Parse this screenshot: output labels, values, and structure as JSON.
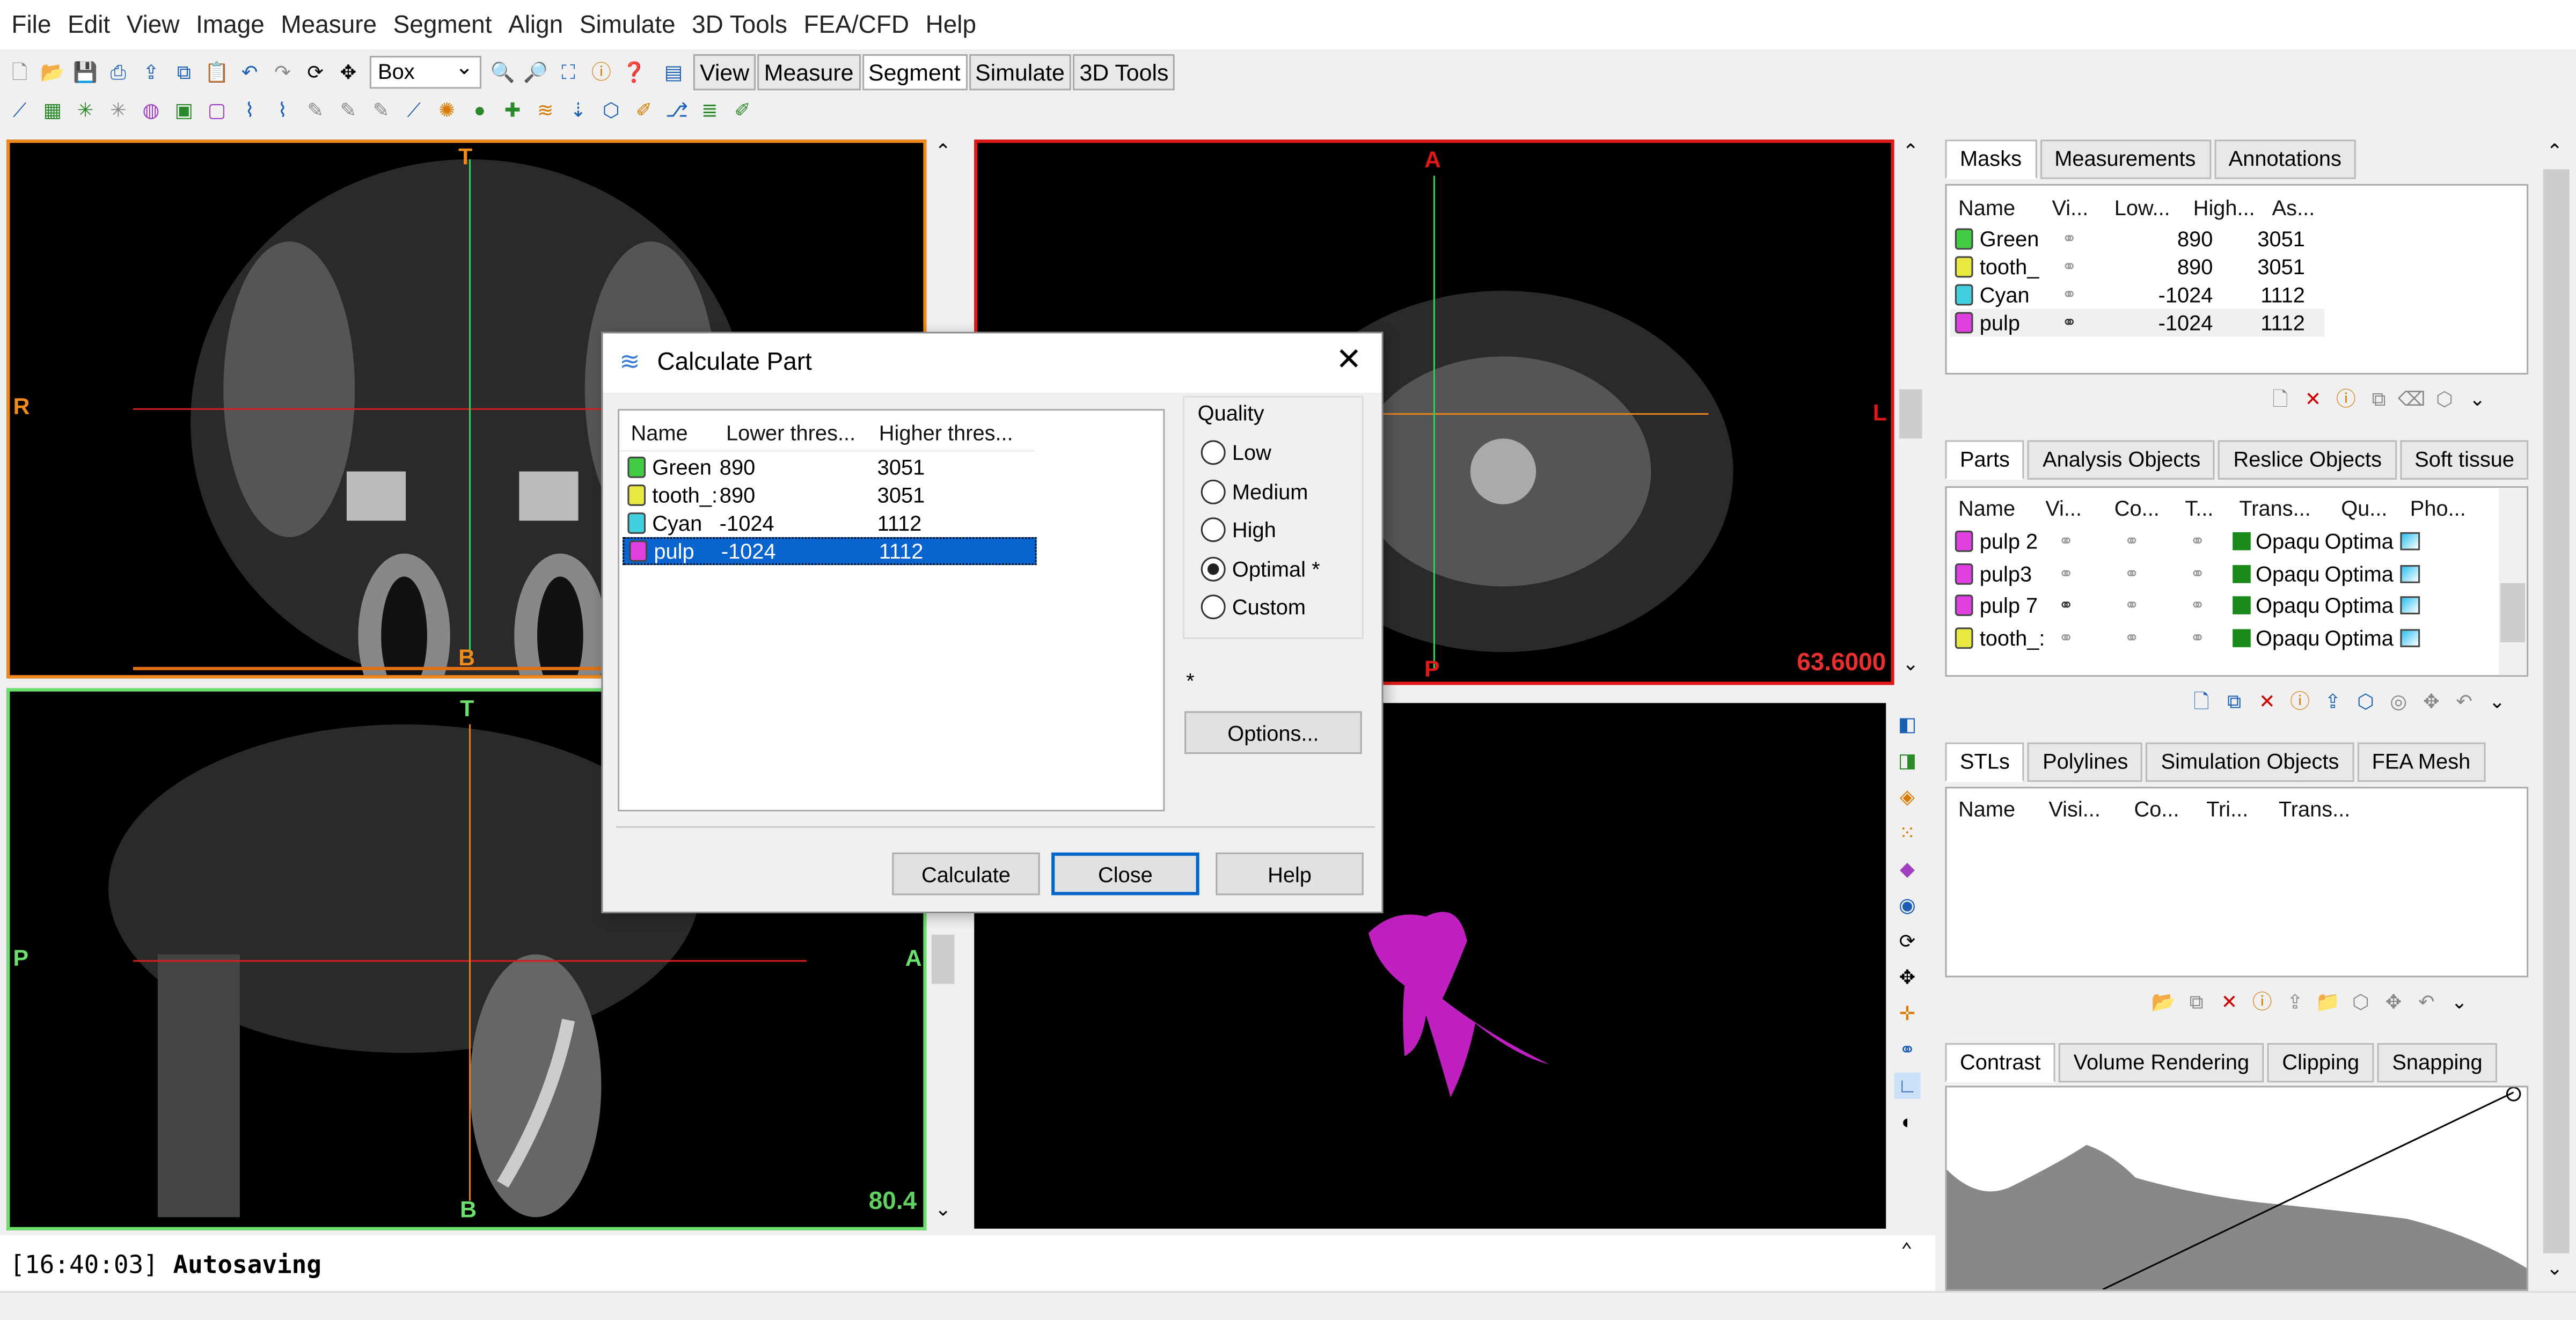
{
  "menu": [
    "File",
    "Edit",
    "View",
    "Image",
    "Measure",
    "Segment",
    "Align",
    "Simulate",
    "3D Tools",
    "FEA/CFD",
    "Help"
  ],
  "toolbar": {
    "select_value": "Box",
    "mode_tabs": [
      "View",
      "Measure",
      "Segment",
      "Simulate",
      "3D Tools"
    ],
    "active_mode": "Segment"
  },
  "viewports": {
    "top_left": {
      "top": "T",
      "left": "R",
      "bottom": "B"
    },
    "top_right": {
      "top": "A",
      "right": "L",
      "bottom": "P",
      "value": "63.6000",
      "value_color": "#e83030"
    },
    "bottom_left": {
      "top": "T",
      "left": "P",
      "right": "A",
      "bottom": "B",
      "value": "80.4",
      "value_color": "#60d060"
    }
  },
  "log": {
    "line1_time": "[16:40:03]",
    "line1_text": "Autosaving"
  },
  "masks_panel": {
    "tabs": [
      "Masks",
      "Measurements",
      "Annotations"
    ],
    "columns": [
      "Name",
      "Vi...",
      "Low...",
      "High...",
      "As..."
    ],
    "rows": [
      {
        "name": "Green",
        "low": "890",
        "high": "3051",
        "color": "#44cc44"
      },
      {
        "name": "tooth_",
        "low": "890",
        "high": "3051",
        "color": "#e8e840"
      },
      {
        "name": "Cyan",
        "low": "-1024",
        "high": "1112",
        "color": "#40d0e0"
      },
      {
        "name": "pulp",
        "low": "-1024",
        "high": "1112",
        "color": "#e040e0"
      }
    ]
  },
  "parts_panel": {
    "tabs": [
      "Parts",
      "Analysis Objects",
      "Reslice Objects",
      "Soft tissue"
    ],
    "columns": [
      "Name",
      "Vi...",
      "Co...",
      "T...",
      "Trans...",
      "Qu...",
      "Pho..."
    ],
    "rows": [
      {
        "name": "pulp 2",
        "trans": "Opaqu",
        "quality": "Optima",
        "color": "#e040e0"
      },
      {
        "name": "pulp3",
        "trans": "Opaqu",
        "quality": "Optima",
        "color": "#e040e0"
      },
      {
        "name": "pulp 7",
        "trans": "Opaqu",
        "quality": "Optima",
        "color": "#e040e0"
      },
      {
        "name": "tooth_:",
        "trans": "Opaqu",
        "quality": "Optima",
        "color": "#e8e840"
      }
    ]
  },
  "stls_panel": {
    "tabs": [
      "STLs",
      "Polylines",
      "Simulation Objects",
      "FEA Mesh"
    ],
    "columns": [
      "Name",
      "Visi...",
      "Co...",
      "Tri...",
      "Trans..."
    ]
  },
  "contrast_panel": {
    "tabs": [
      "Contrast",
      "Volume Rendering",
      "Clipping",
      "Snapping"
    ]
  },
  "dialog": {
    "title": "Calculate Part",
    "columns": [
      "Name",
      "Lower thres...",
      "Higher thres..."
    ],
    "rows": [
      {
        "name": "Green",
        "low": "890",
        "high": "3051",
        "color": "#44cc44"
      },
      {
        "name": "tooth_:",
        "low": "890",
        "high": "3051",
        "color": "#e8e840"
      },
      {
        "name": "Cyan",
        "low": "-1024",
        "high": "1112",
        "color": "#40d0e0"
      },
      {
        "name": "pulp",
        "low": "-1024",
        "high": "1112",
        "color": "#e040e0"
      }
    ],
    "quality_label": "Quality",
    "quality_options": [
      "Low",
      "Medium",
      "High",
      "Optimal *",
      "Custom"
    ],
    "quality_selected": "Optimal *",
    "footnote": "*",
    "options_button": "Options...",
    "calculate_button": "Calculate",
    "close_button": "Close",
    "help_button": "Help"
  }
}
